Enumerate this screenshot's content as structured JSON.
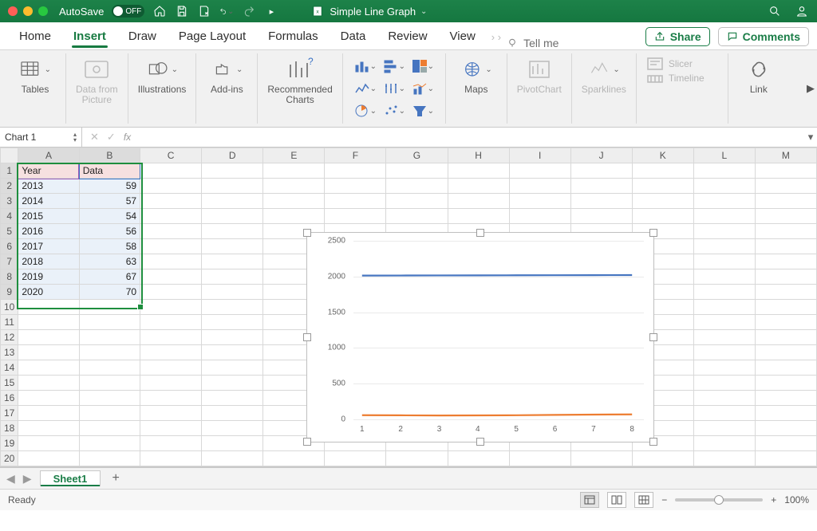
{
  "titlebar": {
    "autosave_label": "AutoSave",
    "autosave_state": "OFF",
    "doc_title": "Simple Line Graph"
  },
  "menutabs": {
    "home": "Home",
    "insert": "Insert",
    "draw": "Draw",
    "page_layout": "Page Layout",
    "formulas": "Formulas",
    "data": "Data",
    "review": "Review",
    "view": "View",
    "tell_me": "Tell me",
    "share": "Share",
    "comments": "Comments",
    "active": "insert"
  },
  "ribbon": {
    "tables": "Tables",
    "data_from_picture": "Data from\nPicture",
    "illustrations": "Illustrations",
    "addins": "Add-ins",
    "recommended_charts": "Recommended\nCharts",
    "maps": "Maps",
    "pivotchart": "PivotChart",
    "sparklines": "Sparklines",
    "slicer": "Slicer",
    "timeline": "Timeline",
    "link": "Link"
  },
  "namebox": {
    "value": "Chart 1"
  },
  "fx": {
    "label": "fx"
  },
  "columns": [
    "A",
    "B",
    "C",
    "D",
    "E",
    "F",
    "G",
    "H",
    "I",
    "J",
    "K",
    "L",
    "M"
  ],
  "row_count": 21,
  "table": {
    "headers": {
      "A": "Year",
      "B": "Data"
    },
    "rows": [
      {
        "A": "2013",
        "B": 59
      },
      {
        "A": "2014",
        "B": 57
      },
      {
        "A": "2015",
        "B": 54
      },
      {
        "A": "2016",
        "B": 56
      },
      {
        "A": "2017",
        "B": 58
      },
      {
        "A": "2018",
        "B": 63
      },
      {
        "A": "2019",
        "B": 67
      },
      {
        "A": "2020",
        "B": 70
      }
    ]
  },
  "chart_data": {
    "type": "line",
    "x": [
      1,
      2,
      3,
      4,
      5,
      6,
      7,
      8
    ],
    "series": [
      {
        "name": "Year",
        "color": "#4675c0",
        "values": [
          2013,
          2014,
          2015,
          2016,
          2017,
          2018,
          2019,
          2020
        ]
      },
      {
        "name": "Data",
        "color": "#ed7d31",
        "values": [
          59,
          57,
          54,
          56,
          58,
          63,
          67,
          70
        ]
      }
    ],
    "ylim": [
      0,
      2500
    ],
    "yticks": [
      0,
      500,
      1000,
      1500,
      2000,
      2500
    ],
    "xticks": [
      1,
      2,
      3,
      4,
      5,
      6,
      7,
      8
    ],
    "title": "",
    "xlabel": "",
    "ylabel": ""
  },
  "sheet_tabs": {
    "active": "Sheet1"
  },
  "statusbar": {
    "status": "Ready",
    "zoom": "100%"
  }
}
